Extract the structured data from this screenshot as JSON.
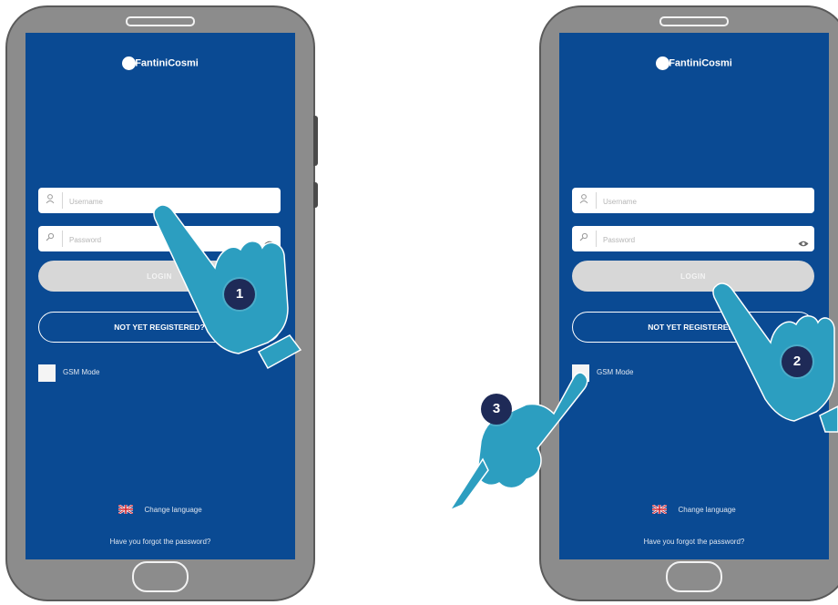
{
  "brand": "FantiniCosmi",
  "colors": {
    "screen": "#0a4a93",
    "phone_body": "#8c8c8c",
    "login_button": "#d7d7d7",
    "hand": "#2c9ec0",
    "badge": "#1e2a57"
  },
  "login_screen": {
    "username_placeholder": "Username",
    "password_placeholder": "Password",
    "login_label": "LOGIN",
    "register_label": "NOT YET REGISTERED?",
    "gsm_label": "GSM Mode",
    "change_language_label": "Change language",
    "forgot_password_label": "Have you forgot the password?",
    "icons": [
      "user-icon",
      "lock-icon",
      "eye-icon",
      "uk-flag-icon"
    ]
  },
  "steps": [
    "1",
    "2",
    "3"
  ]
}
